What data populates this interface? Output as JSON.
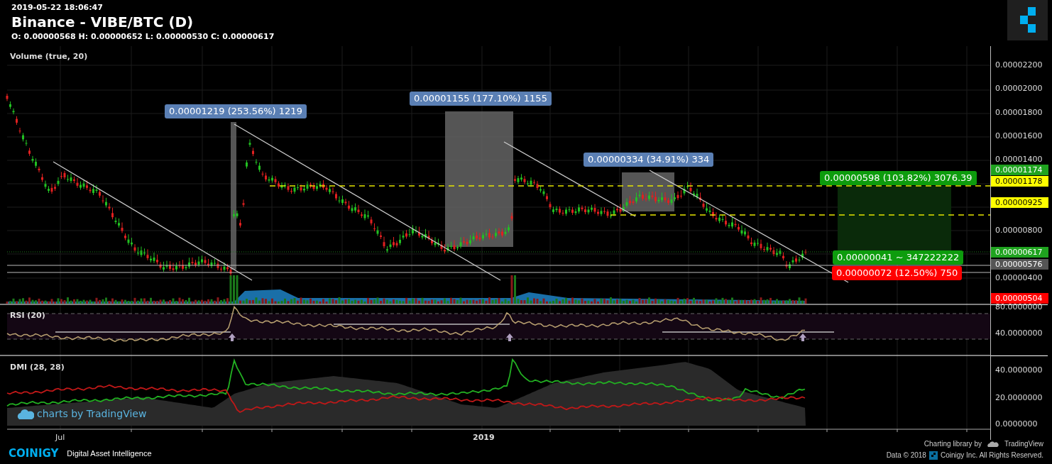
{
  "header": {
    "timestamp": "2019-05-22 18:06:47",
    "title": "Binance - VIBE/BTC (D)",
    "ohlc": "O: 0.00000568 H: 0.00000652 L: 0.00000530 C: 0.00000617"
  },
  "price_pane": {
    "indicator_label": "Volume (true, 20)",
    "axis_ticks": [
      "0.00002200",
      "0.00002000",
      "0.00001800",
      "0.00001600",
      "0.00001400",
      "0.00000800",
      "0.00000400"
    ],
    "price_badges": [
      {
        "text": "0.00001174",
        "color": "#1fa31f"
      },
      {
        "text": "0.00001178",
        "color": "#ffff00"
      },
      {
        "text": "0.00000925",
        "color": "#ffff00"
      },
      {
        "text": "0.00000617",
        "color": "#1fa31f"
      },
      {
        "text": "0.00000576",
        "color": "#555555"
      },
      {
        "text": "0.00000504",
        "color": "#ff0000"
      }
    ],
    "measure_labels": [
      {
        "text": "0.00001219 (253.56%) 1219",
        "color": "#5a7fb4"
      },
      {
        "text": "0.00001155 (177.10%) 1155",
        "color": "#5a7fb4"
      },
      {
        "text": "0.00000334 (34.91%) 334",
        "color": "#5a7fb4"
      },
      {
        "text": "0.00000598 (103.82%) 3076.39",
        "color": "#0d9c0d"
      },
      {
        "text": "0.00000041 ~ 347222222",
        "color": "#0d9c0d"
      },
      {
        "text": "0.00000072 (12.50%) 750",
        "color": "#ff0000"
      }
    ]
  },
  "rsi_pane": {
    "label": "RSI (20)",
    "axis_ticks": [
      "80.0000000",
      "40.0000000"
    ]
  },
  "dmi_pane": {
    "label": "DMI (28, 28)",
    "axis_ticks": [
      "40.0000000",
      "20.0000000",
      "0.0000000"
    ],
    "attribution": "charts by TradingView"
  },
  "x_axis": {
    "labels": [
      {
        "text": "Jul",
        "bold": false
      },
      {
        "text": "2019",
        "bold": true
      }
    ]
  },
  "footer": {
    "brand": "COINIGY",
    "tagline": "Digital Asset Intelligence",
    "library_text": "Charting library by",
    "library_name": "TradingView",
    "copyright_year": "Data © 2018",
    "copyright_owner": "Coinigy Inc. All Rights Reserved."
  }
}
